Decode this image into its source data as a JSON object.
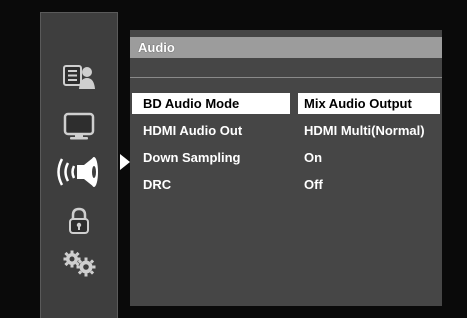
{
  "sidebar": {
    "icons": [
      {
        "name": "info-icon"
      },
      {
        "name": "display-icon"
      },
      {
        "name": "audio-icon",
        "active": true
      },
      {
        "name": "lock-icon"
      },
      {
        "name": "settings-icon"
      }
    ]
  },
  "panel": {
    "title": "Audio",
    "rows": [
      {
        "label": "BD Audio Mode",
        "value": "Mix Audio Output",
        "selected": true
      },
      {
        "label": "HDMI Audio Out",
        "value": "HDMI Multi(Normal)",
        "selected": false
      },
      {
        "label": "Down Sampling",
        "value": "On",
        "selected": false
      },
      {
        "label": "DRC",
        "value": "Off",
        "selected": false
      }
    ]
  },
  "colors": {
    "background": "#0a0a0a",
    "sidebar": "#3e3e3e",
    "panel": "#464646",
    "title_bar": "#9c9c9c",
    "selection": "#ffffff",
    "text": "#ffffff"
  }
}
